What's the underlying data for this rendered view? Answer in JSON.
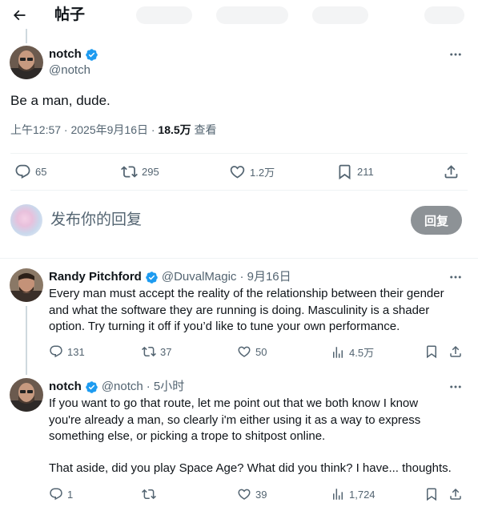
{
  "header": {
    "title": "帖子"
  },
  "main_post": {
    "name": "notch",
    "handle": "@notch",
    "text": "Be a man, dude.",
    "time": "上午12:57 · 2025年9月16日 · ",
    "views": "18.5万",
    "views_label": " 查看",
    "stats": {
      "replies": "65",
      "reposts": "295",
      "likes": "1.2万",
      "bookmarks": "211"
    }
  },
  "composer": {
    "placeholder": "发布你的回复",
    "button": "回复"
  },
  "replies": [
    {
      "name": "Randy Pitchford",
      "handle": "@DuvalMagic",
      "time": "· 9月16日",
      "lines": [
        "Every man must accept the reality of the relationship between their gender",
        "and what the software they are running is doing. Masculinity is a shader",
        "option. Try turning it off if you’d like to tune your own performance."
      ],
      "stats": {
        "replies": "131",
        "reposts": "37",
        "likes": "50",
        "views": "4.5万"
      }
    },
    {
      "name": "notch",
      "handle": "@notch",
      "time": "· 5小时",
      "lines": [
        "If you want to go that route, let me point out that we both know I know",
        "you're already a man, so clearly i'm either using it as a way to express",
        "something else, or picking a trope to shitpost online."
      ],
      "lines2": [
        "That aside, did you play Space Age? What did you think? I have... thoughts."
      ],
      "stats": {
        "replies": "1",
        "reposts": "",
        "likes": "39",
        "views": "1,724"
      }
    }
  ],
  "colors": {
    "verified": "#1d9bf0",
    "secondary_text": "#536471",
    "reply_button": "#8d9296"
  }
}
